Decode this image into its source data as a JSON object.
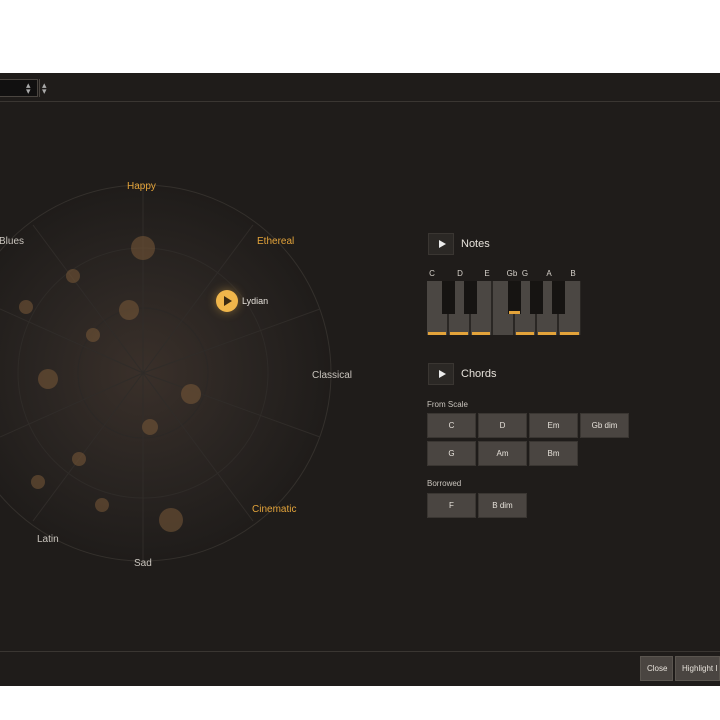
{
  "wheel": {
    "labels": {
      "happy": "Happy",
      "ethereal": "Ethereal",
      "blues": "Blues",
      "classical": "Classical",
      "cinematic": "Cinematic",
      "latin": "Latin",
      "sad": "Sad"
    },
    "selected_mode": "Lydian"
  },
  "notes": {
    "title": "Notes",
    "keys": [
      "C",
      "D",
      "E",
      "Gb",
      "G",
      "A",
      "B"
    ]
  },
  "chords": {
    "title": "Chords",
    "from_scale_label": "From Scale",
    "from_scale": [
      "C",
      "D",
      "Em",
      "Gb dim",
      "G",
      "Am",
      "Bm"
    ],
    "borrowed_label": "Borrowed",
    "borrowed": [
      "F",
      "B dim"
    ]
  },
  "footer": {
    "close_label": "Close",
    "highlight_label": "Highlight I"
  },
  "colors": {
    "accent": "#e3a33a",
    "background": "#1f1c1a",
    "button": "#4a4541"
  }
}
